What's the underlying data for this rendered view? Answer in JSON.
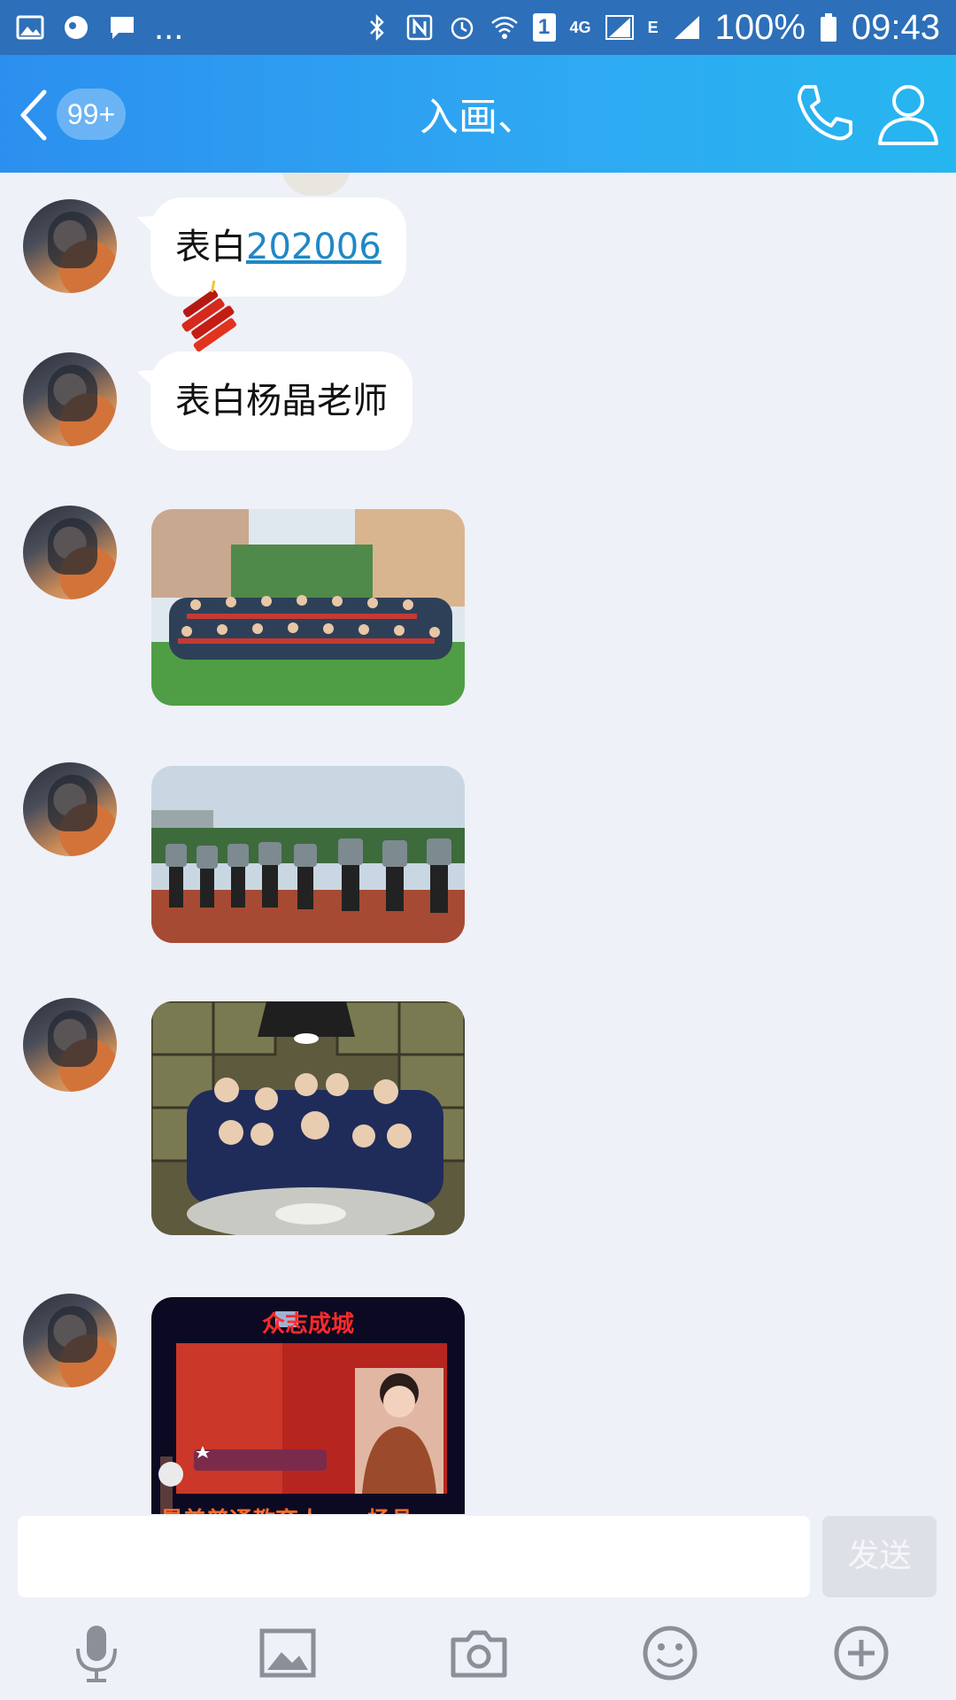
{
  "status_bar": {
    "battery": "100%",
    "time": "09:43",
    "sim": "1",
    "net_4g": "4G",
    "net_e": "E",
    "more": "..."
  },
  "header": {
    "unread_badge": "99+",
    "title": "入画、"
  },
  "messages": [
    {
      "type": "text",
      "prefix": "表白",
      "link": "202006"
    },
    {
      "type": "text",
      "text": "表白杨晶老师"
    },
    {
      "type": "image",
      "alt": "group photo on sports field"
    },
    {
      "type": "image",
      "alt": "students in formation on track"
    },
    {
      "type": "image",
      "alt": "students at dinner table"
    },
    {
      "type": "image",
      "caption_top": "众志成城",
      "caption_bottom": "最美普通教育人——杨晶"
    }
  ],
  "input": {
    "placeholder": "",
    "send_label": "发送"
  },
  "toolbar": [
    "microphone-icon",
    "image-icon",
    "camera-icon",
    "emoji-icon",
    "plus-icon"
  ],
  "colors": {
    "header_start": "#2c8fef",
    "header_end": "#26b6ef",
    "background": "#eef1f7",
    "link": "#1e88c7"
  }
}
